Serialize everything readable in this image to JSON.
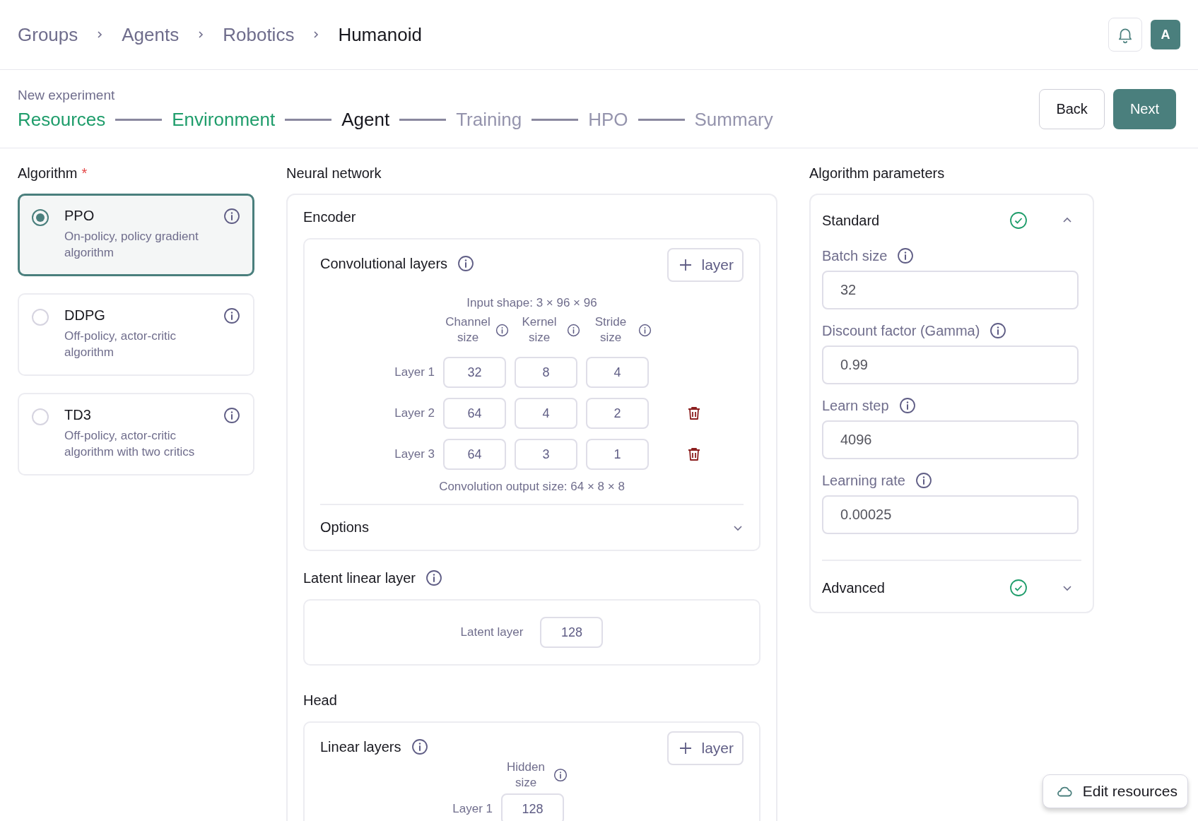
{
  "breadcrumb": [
    {
      "label": "Groups",
      "current": false
    },
    {
      "label": "Agents",
      "current": false
    },
    {
      "label": "Robotics",
      "current": false
    },
    {
      "label": "Humanoid",
      "current": true
    }
  ],
  "avatar": "A",
  "experiment": {
    "title": "New experiment",
    "steps": [
      {
        "label": "Resources",
        "completed": true,
        "selected": false
      },
      {
        "label": "Environment",
        "completed": true,
        "selected": false
      },
      {
        "label": "Agent",
        "completed": false,
        "selected": true
      },
      {
        "label": "Training",
        "completed": false,
        "selected": false
      },
      {
        "label": "HPO",
        "completed": false,
        "selected": false
      },
      {
        "label": "Summary",
        "completed": false,
        "selected": false
      }
    ],
    "back": "Back",
    "next": "Next"
  },
  "algorithm": {
    "title": "Algorithm",
    "required_mark": "*",
    "options": [
      {
        "name": "PPO",
        "description": "On-policy, policy gradient algorithm",
        "selected": true
      },
      {
        "name": "DDPG",
        "description": "Off-policy, actor-critic algorithm",
        "selected": false
      },
      {
        "name": "TD3",
        "description": "Off-policy, actor-critic algorithm with two critics",
        "selected": false
      }
    ]
  },
  "neural_network": {
    "title": "Neural network",
    "encoder": {
      "title": "Encoder",
      "conv": {
        "title": "Convolutional layers",
        "add_button": "layer",
        "input_shape": "Input shape: 3 × 96 × 96",
        "columns": [
          "Channel size",
          "Kernel size",
          "Stride size"
        ],
        "rows": [
          {
            "label": "Layer 1",
            "values": [
              "32",
              "8",
              "4"
            ],
            "deletable": false
          },
          {
            "label": "Layer 2",
            "values": [
              "64",
              "4",
              "2"
            ],
            "deletable": true
          },
          {
            "label": "Layer 3",
            "values": [
              "64",
              "3",
              "1"
            ],
            "deletable": true
          }
        ],
        "output": "Convolution output size: 64 × 8 × 8",
        "options": {
          "label": "Options",
          "expanded": false
        }
      }
    },
    "latent": {
      "title": "Latent linear layer",
      "field_label": "Latent layer",
      "value": "128"
    },
    "head": {
      "title": "Head",
      "linear": {
        "title": "Linear layers",
        "add_button": "layer",
        "columns": [
          "Hidden size"
        ],
        "rows": [
          {
            "label": "Layer 1",
            "values": [
              "128"
            ]
          }
        ]
      }
    }
  },
  "algorithm_parameters": {
    "title": "Algorithm parameters",
    "sections": [
      {
        "title": "Standard",
        "valid": true,
        "expanded": true,
        "fields": [
          {
            "label": "Batch size",
            "value": "32"
          },
          {
            "label": "Discount factor (Gamma)",
            "value": "0.99"
          },
          {
            "label": "Learn step",
            "value": "4096"
          },
          {
            "label": "Learning rate",
            "value": "0.00025"
          }
        ]
      },
      {
        "title": "Advanced",
        "valid": true,
        "expanded": false
      }
    ]
  },
  "edit_resources": "Edit resources"
}
